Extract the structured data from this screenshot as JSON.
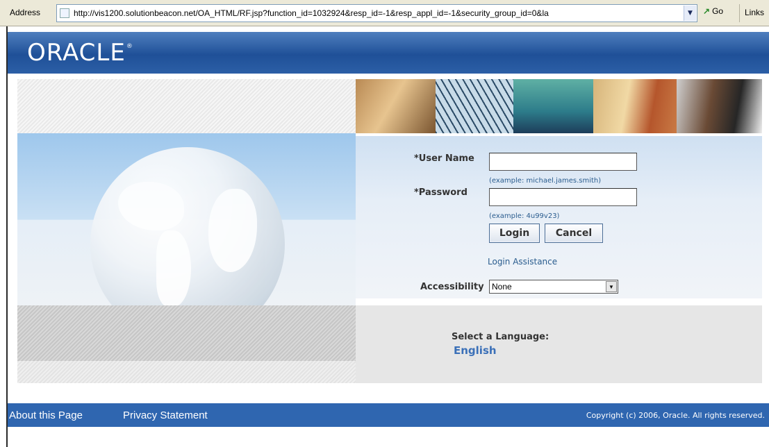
{
  "browser": {
    "address_label": "Address",
    "url": "http://vis1200.solutionbeacon.net/OA_HTML/RF.jsp?function_id=1032924&resp_id=-1&resp_appl_id=-1&security_group_id=0&la",
    "go_label": "Go",
    "links_label": "Links"
  },
  "header": {
    "logo_text": "ORACLE",
    "logo_mark": "®"
  },
  "login": {
    "username_label": "*User Name",
    "username_value": "",
    "username_hint": "(example: michael.james.smith)",
    "password_label": "*Password",
    "password_value": "",
    "password_hint": "(example: 4u99v23)",
    "login_button": "Login",
    "cancel_button": "Cancel",
    "assistance_link": "Login Assistance",
    "accessibility_label": "Accessibility",
    "accessibility_selected": "None"
  },
  "language": {
    "label": "Select a Language:",
    "option": "English"
  },
  "footer": {
    "about_link": "About this Page",
    "privacy_link": "Privacy Statement",
    "copyright": "Copyright (c) 2006, Oracle. All rights reserved."
  },
  "colors": {
    "header_blue": "#1f5098",
    "footer_blue": "#2f66b0",
    "link_blue": "#2a5c8e"
  }
}
